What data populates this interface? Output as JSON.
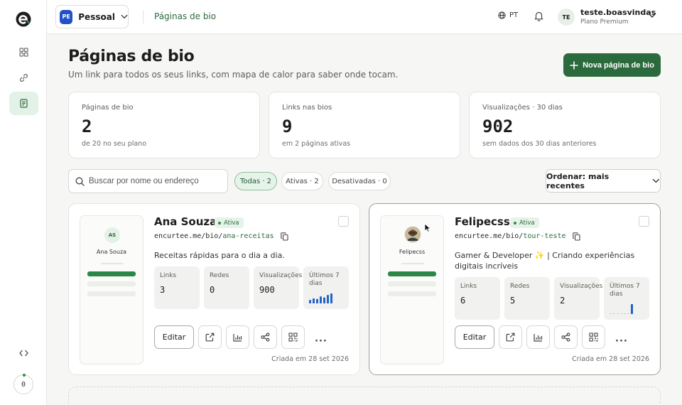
{
  "sidebar": {
    "nav": [
      {
        "icon": "grid-icon",
        "active": false
      },
      {
        "icon": "link-icon",
        "active": false
      },
      {
        "icon": "document-icon",
        "active": true
      }
    ],
    "bottom_icon": "code-icon",
    "credits": "0"
  },
  "topbar": {
    "workspace_badge": "PE",
    "workspace_name": "Pessoal",
    "breadcrumb": "Páginas de bio",
    "language": "PT",
    "user_initials": "TE",
    "user_name": "teste.boasvindas",
    "user_plan": "Plano Premium"
  },
  "header": {
    "title": "Páginas de bio",
    "subtitle": "Um link para todos os seus links, com mapa de calor para saber onde tocam.",
    "new_button": "Nova página de bio"
  },
  "stats": [
    {
      "label": "Páginas de bio",
      "value": "2",
      "sub": "de 20 no seu plano"
    },
    {
      "label": "Links nas bios",
      "value": "9",
      "sub": "em 2 páginas ativas"
    },
    {
      "label": "Visualizações · 30 dias",
      "value": "902",
      "sub": "sem dados dos 30 dias anteriores"
    }
  ],
  "filters": {
    "search_placeholder": "Buscar por nome ou endereço",
    "chips": [
      "Todas · 2",
      "Ativas · 2",
      "Desativadas · 0"
    ],
    "active_chip": 0,
    "sort": "Ordenar: mais recentes"
  },
  "cards": [
    {
      "phone_avatar": "AS",
      "phone_name": "Ana Souza",
      "name": "Ana Souza",
      "status": "Ativa",
      "url_prefix": "encurtee.me/bio/",
      "slug": "ana-receitas",
      "description": "Receitas rápidas para o dia a dia.",
      "stats": [
        {
          "label": "Links",
          "value": "3"
        },
        {
          "label": "Redes",
          "value": "0"
        },
        {
          "label": "Visualizações",
          "value": "900"
        }
      ],
      "spark_label": "Últimos 7 dias",
      "spark": [
        0.35,
        0.5,
        0.45,
        0.7,
        0.6,
        0.85,
        1.0
      ],
      "edit": "Editar",
      "created": "Criada em 28 set 2026"
    },
    {
      "phone_avatar": "",
      "phone_name": "Felipecss",
      "name": "Felipecss",
      "status": "Ativa",
      "url_prefix": "encurtee.me/bio/",
      "slug": "tour-teste",
      "description": "Gamer & Developer ✨ | Criando experiências digitais incríveis",
      "stats": [
        {
          "label": "Links",
          "value": "6"
        },
        {
          "label": "Redes",
          "value": "5"
        },
        {
          "label": "Visualizações",
          "value": "2"
        }
      ],
      "spark_label": "Últimos 7 dias",
      "spark": [
        0,
        0,
        0,
        0,
        0,
        0,
        1.0
      ],
      "edit": "Editar",
      "created": "Criada em 28 set 2026"
    }
  ],
  "colors": {
    "accent": "#2b6a3d",
    "accent_light": "#e6f3e8",
    "spark_blue": "#2563c9"
  }
}
